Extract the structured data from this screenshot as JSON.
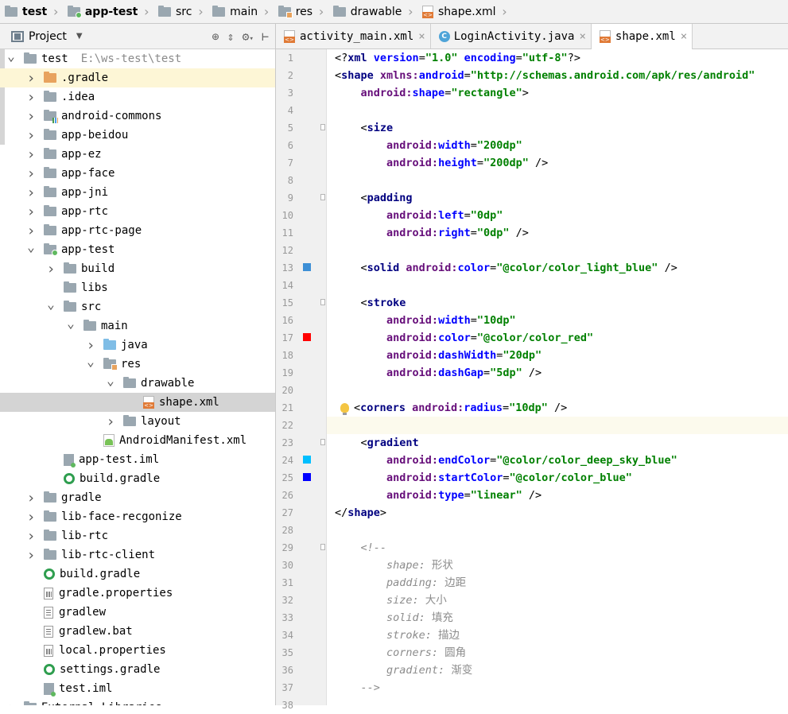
{
  "breadcrumb": [
    {
      "label": "test",
      "icon": "project-icon",
      "bold": true
    },
    {
      "label": "app-test",
      "icon": "module-folder-icon",
      "bold": true
    },
    {
      "label": "src",
      "icon": "folder-icon"
    },
    {
      "label": "main",
      "icon": "folder-icon"
    },
    {
      "label": "res",
      "icon": "res-folder-icon"
    },
    {
      "label": "drawable",
      "icon": "folder-icon"
    },
    {
      "label": "shape.xml",
      "icon": "xml-file-icon"
    }
  ],
  "project_panel": {
    "title": "Project",
    "tools": [
      "locate-icon",
      "collapse-icon",
      "gear-icon",
      "hide-icon"
    ]
  },
  "tree": [
    {
      "label": "test",
      "path": "E:\\ws-test\\test",
      "depth": 0,
      "arrow": "down",
      "icon": "project-icon"
    },
    {
      "label": ".gradle",
      "depth": 1,
      "arrow": "right",
      "icon": "folder-orange-icon",
      "highlight": true
    },
    {
      "label": ".idea",
      "depth": 1,
      "arrow": "right",
      "icon": "folder-icon"
    },
    {
      "label": "android-commons",
      "depth": 1,
      "arrow": "right",
      "icon": "library-module-icon"
    },
    {
      "label": "app-beidou",
      "depth": 1,
      "arrow": "right",
      "icon": "folder-icon"
    },
    {
      "label": "app-ez",
      "depth": 1,
      "arrow": "right",
      "icon": "folder-icon"
    },
    {
      "label": "app-face",
      "depth": 1,
      "arrow": "right",
      "icon": "folder-icon"
    },
    {
      "label": "app-jni",
      "depth": 1,
      "arrow": "right",
      "icon": "folder-icon"
    },
    {
      "label": "app-rtc",
      "depth": 1,
      "arrow": "right",
      "icon": "folder-icon"
    },
    {
      "label": "app-rtc-page",
      "depth": 1,
      "arrow": "right",
      "icon": "folder-icon"
    },
    {
      "label": "app-test",
      "depth": 1,
      "arrow": "down",
      "icon": "module-folder-icon"
    },
    {
      "label": "build",
      "depth": 2,
      "arrow": "right",
      "icon": "folder-icon"
    },
    {
      "label": "libs",
      "depth": 2,
      "arrow": "",
      "icon": "folder-icon"
    },
    {
      "label": "src",
      "depth": 2,
      "arrow": "down",
      "icon": "folder-icon"
    },
    {
      "label": "main",
      "depth": 3,
      "arrow": "down",
      "icon": "folder-icon"
    },
    {
      "label": "java",
      "depth": 4,
      "arrow": "right",
      "icon": "source-folder-icon"
    },
    {
      "label": "res",
      "depth": 4,
      "arrow": "down",
      "icon": "res-folder-icon"
    },
    {
      "label": "drawable",
      "depth": 5,
      "arrow": "down",
      "icon": "folder-icon"
    },
    {
      "label": "shape.xml",
      "depth": 6,
      "arrow": "",
      "icon": "xml-file-icon",
      "selected": true
    },
    {
      "label": "layout",
      "depth": 5,
      "arrow": "right",
      "icon": "folder-icon"
    },
    {
      "label": "AndroidManifest.xml",
      "depth": 4,
      "arrow": "",
      "icon": "manifest-file-icon"
    },
    {
      "label": "app-test.iml",
      "depth": 2,
      "arrow": "",
      "icon": "iml-file-icon"
    },
    {
      "label": "build.gradle",
      "depth": 2,
      "arrow": "",
      "icon": "gradle-file-icon"
    },
    {
      "label": "gradle",
      "depth": 1,
      "arrow": "right",
      "icon": "folder-icon"
    },
    {
      "label": "lib-face-recgonize",
      "depth": 1,
      "arrow": "right",
      "icon": "folder-icon"
    },
    {
      "label": "lib-rtc",
      "depth": 1,
      "arrow": "right",
      "icon": "folder-icon"
    },
    {
      "label": "lib-rtc-client",
      "depth": 1,
      "arrow": "right",
      "icon": "folder-icon"
    },
    {
      "label": "build.gradle",
      "depth": 1,
      "arrow": "",
      "icon": "gradle-file-icon"
    },
    {
      "label": "gradle.properties",
      "depth": 1,
      "arrow": "",
      "icon": "properties-file-icon"
    },
    {
      "label": "gradlew",
      "depth": 1,
      "arrow": "",
      "icon": "text-file-icon"
    },
    {
      "label": "gradlew.bat",
      "depth": 1,
      "arrow": "",
      "icon": "text-file-icon"
    },
    {
      "label": "local.properties",
      "depth": 1,
      "arrow": "",
      "icon": "properties-file-icon"
    },
    {
      "label": "settings.gradle",
      "depth": 1,
      "arrow": "",
      "icon": "gradle-file-icon"
    },
    {
      "label": "test.iml",
      "depth": 1,
      "arrow": "",
      "icon": "iml-file-icon"
    },
    {
      "label": "External Libraries",
      "depth": 0,
      "arrow": "right",
      "icon": "library-icon"
    }
  ],
  "tabs": [
    {
      "label": "activity_main.xml",
      "icon": "xml-file-icon",
      "active": false
    },
    {
      "label": "LoginActivity.java",
      "icon": "class-file-icon",
      "active": false
    },
    {
      "label": "shape.xml",
      "icon": "xml-file-icon",
      "active": true
    }
  ],
  "tab_close_glyph": "×",
  "gutter_swatches": {
    "13": "#3d8fd6",
    "17": "#ff0000",
    "24": "#00bfff",
    "25": "#0000ff"
  },
  "fold_markers": [
    5,
    9,
    15,
    23,
    29
  ],
  "current_line": 22,
  "bulb_line": 21,
  "code_lines": [
    [
      [
        "pun",
        "<?"
      ],
      [
        "tag",
        "xml "
      ],
      [
        "aname",
        "version"
      ],
      [
        "pun",
        "="
      ],
      [
        "aval",
        "\"1.0\" "
      ],
      [
        "aname",
        "encoding"
      ],
      [
        "pun",
        "="
      ],
      [
        "aval",
        "\"utf-8\""
      ],
      [
        "pun",
        "?>"
      ]
    ],
    [
      [
        "pun",
        "<"
      ],
      [
        "tag",
        "shape "
      ],
      [
        "ns",
        "xmlns:"
      ],
      [
        "aname",
        "android"
      ],
      [
        "pun",
        "="
      ],
      [
        "aval",
        "\"http://schemas.android.com/apk/res/android\""
      ]
    ],
    [
      [
        "pun",
        "    "
      ],
      [
        "ns",
        "android:"
      ],
      [
        "aname",
        "shape"
      ],
      [
        "pun",
        "="
      ],
      [
        "aval",
        "\"rectangle\""
      ],
      [
        "pun",
        ">"
      ]
    ],
    [],
    [
      [
        "pun",
        "    <"
      ],
      [
        "tag",
        "size"
      ]
    ],
    [
      [
        "pun",
        "        "
      ],
      [
        "ns",
        "android:"
      ],
      [
        "aname",
        "width"
      ],
      [
        "pun",
        "="
      ],
      [
        "aval",
        "\"200dp\""
      ]
    ],
    [
      [
        "pun",
        "        "
      ],
      [
        "ns",
        "android:"
      ],
      [
        "aname",
        "height"
      ],
      [
        "pun",
        "="
      ],
      [
        "aval",
        "\"200dp\""
      ],
      [
        "pun",
        " />"
      ]
    ],
    [],
    [
      [
        "pun",
        "    <"
      ],
      [
        "tag",
        "padding"
      ]
    ],
    [
      [
        "pun",
        "        "
      ],
      [
        "ns",
        "android:"
      ],
      [
        "aname",
        "left"
      ],
      [
        "pun",
        "="
      ],
      [
        "aval",
        "\"0dp\""
      ]
    ],
    [
      [
        "pun",
        "        "
      ],
      [
        "ns",
        "android:"
      ],
      [
        "aname",
        "right"
      ],
      [
        "pun",
        "="
      ],
      [
        "aval",
        "\"0dp\""
      ],
      [
        "pun",
        " />"
      ]
    ],
    [],
    [
      [
        "pun",
        "    <"
      ],
      [
        "tag",
        "solid "
      ],
      [
        "ns",
        "android:"
      ],
      [
        "aname",
        "color"
      ],
      [
        "pun",
        "="
      ],
      [
        "aval",
        "\"@color/color_light_blue\""
      ],
      [
        "pun",
        " />"
      ]
    ],
    [],
    [
      [
        "pun",
        "    <"
      ],
      [
        "tag",
        "stroke"
      ]
    ],
    [
      [
        "pun",
        "        "
      ],
      [
        "ns",
        "android:"
      ],
      [
        "aname",
        "width"
      ],
      [
        "pun",
        "="
      ],
      [
        "aval",
        "\"10dp\""
      ]
    ],
    [
      [
        "pun",
        "        "
      ],
      [
        "ns",
        "android:"
      ],
      [
        "aname",
        "color"
      ],
      [
        "pun",
        "="
      ],
      [
        "aval",
        "\"@color/color_red\""
      ]
    ],
    [
      [
        "pun",
        "        "
      ],
      [
        "ns",
        "android:"
      ],
      [
        "aname",
        "dashWidth"
      ],
      [
        "pun",
        "="
      ],
      [
        "aval",
        "\"20dp\""
      ]
    ],
    [
      [
        "pun",
        "        "
      ],
      [
        "ns",
        "android:"
      ],
      [
        "aname",
        "dashGap"
      ],
      [
        "pun",
        "="
      ],
      [
        "aval",
        "\"5dp\""
      ],
      [
        "pun",
        " />"
      ]
    ],
    [],
    [
      [
        "pun",
        "<"
      ],
      [
        "tag",
        "corners "
      ],
      [
        "ns",
        "android:"
      ],
      [
        "aname",
        "radius"
      ],
      [
        "pun",
        "="
      ],
      [
        "aval",
        "\"10dp\""
      ],
      [
        "pun",
        " />"
      ]
    ],
    [],
    [
      [
        "pun",
        "    <"
      ],
      [
        "tag",
        "gradient"
      ]
    ],
    [
      [
        "pun",
        "        "
      ],
      [
        "ns",
        "android:"
      ],
      [
        "aname",
        "endColor"
      ],
      [
        "pun",
        "="
      ],
      [
        "aval",
        "\"@color/color_deep_sky_blue\""
      ]
    ],
    [
      [
        "pun",
        "        "
      ],
      [
        "ns",
        "android:"
      ],
      [
        "aname",
        "startColor"
      ],
      [
        "pun",
        "="
      ],
      [
        "aval",
        "\"@color/color_blue\""
      ]
    ],
    [
      [
        "pun",
        "        "
      ],
      [
        "ns",
        "android:"
      ],
      [
        "aname",
        "type"
      ],
      [
        "pun",
        "="
      ],
      [
        "aval",
        "\"linear\""
      ],
      [
        "pun",
        " />"
      ]
    ],
    [
      [
        "pun",
        "</"
      ],
      [
        "tag",
        "shape"
      ],
      [
        "pun",
        ">"
      ]
    ],
    [],
    [
      [
        "cmt",
        "    <!--"
      ]
    ],
    [
      [
        "cmt",
        "        shape: "
      ],
      [
        "cjk",
        "形状"
      ]
    ],
    [
      [
        "cmt",
        "        padding: "
      ],
      [
        "cjk",
        "边距"
      ]
    ],
    [
      [
        "cmt",
        "        size: "
      ],
      [
        "cjk",
        "大小"
      ]
    ],
    [
      [
        "cmt",
        "        solid: "
      ],
      [
        "cjk",
        "填充"
      ]
    ],
    [
      [
        "cmt",
        "        stroke: "
      ],
      [
        "cjk",
        "描边"
      ]
    ],
    [
      [
        "cmt",
        "        corners: "
      ],
      [
        "cjk",
        "圆角"
      ]
    ],
    [
      [
        "cmt",
        "        gradient: "
      ],
      [
        "cjk",
        "渐变"
      ]
    ],
    [
      [
        "cmt",
        "    -->"
      ]
    ],
    []
  ]
}
